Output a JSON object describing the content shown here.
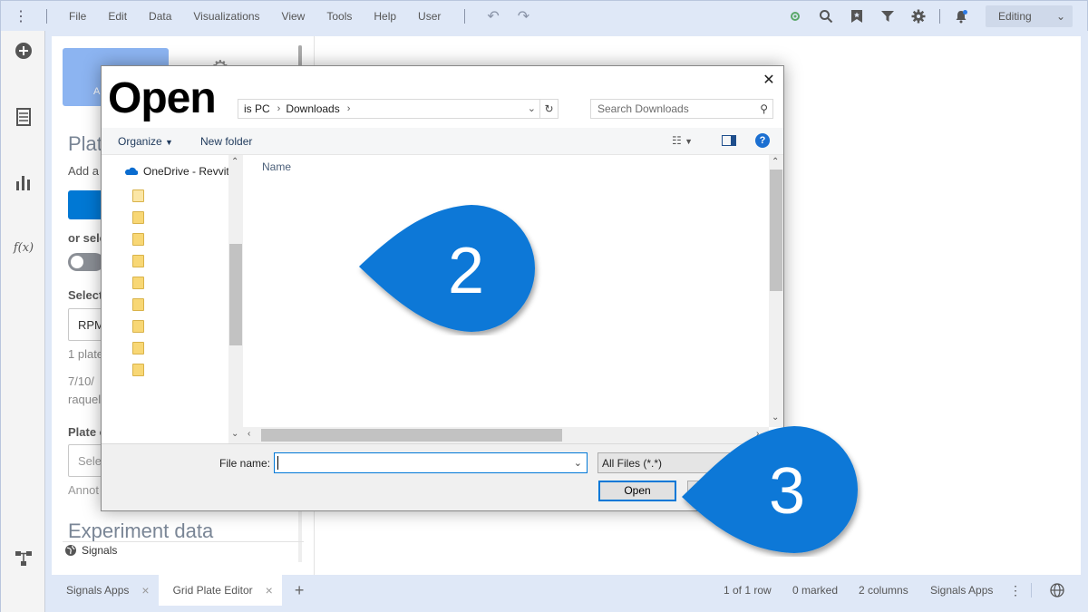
{
  "menubar": {
    "items": [
      "File",
      "Edit",
      "Data",
      "Visualizations",
      "View",
      "Tools",
      "Help",
      "User"
    ],
    "mode": "Editing"
  },
  "left_panel": {
    "tile_label": "A",
    "heading": "Plat",
    "add_text": "Add a",
    "or_select": "or sele",
    "select_label": "Select",
    "select_value": "RPM",
    "count_text": "1 plate",
    "date_text": "7/10/",
    "user_text": "raquel",
    "plate_label": "Plate c",
    "plate_placeholder": "Sele",
    "annot_text": "Annot",
    "experiment_heading": "Experiment data",
    "signals_label": "Signals"
  },
  "bottombar": {
    "tabs": [
      {
        "label": "Signals Apps"
      },
      {
        "label": "Grid Plate Editor"
      }
    ],
    "status_rows": "1 of 1 row",
    "status_marked": "0 marked",
    "status_columns": "2 columns",
    "status_app": "Signals Apps"
  },
  "dialog": {
    "title": "Open",
    "breadcrumb_pc": "is PC",
    "breadcrumb_folder": "Downloads",
    "search_placeholder": "Search Downloads",
    "organize_label": "Organize",
    "new_folder_label": "New folder",
    "help_glyph": "?",
    "nav_onedrive": "OneDrive - Revvity",
    "column_name": "Name",
    "file_name_label": "File name:",
    "file_name_value": "",
    "file_type": "All Files (*.*)",
    "open_label": "Open"
  },
  "callouts": [
    {
      "number": "2"
    },
    {
      "number": "3"
    }
  ],
  "colors": {
    "callout": "#0a78d7",
    "accent": "#0078d7",
    "menubar_bg": "#dfe8f7"
  }
}
